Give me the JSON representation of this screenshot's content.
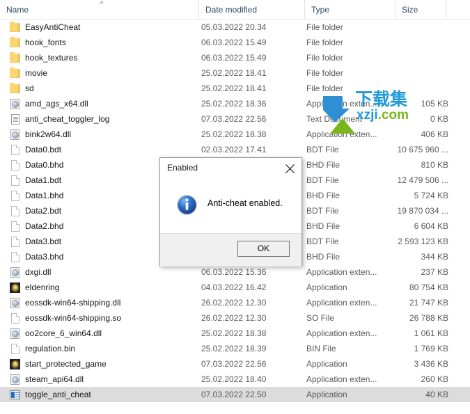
{
  "explorer": {
    "columns": [
      {
        "key": "name",
        "label": "Name"
      },
      {
        "key": "date",
        "label": "Date modified"
      },
      {
        "key": "type",
        "label": "Type"
      },
      {
        "key": "size",
        "label": "Size"
      }
    ],
    "sort": {
      "column": "Name",
      "direction": "ascending",
      "glyph": "^"
    },
    "rows": [
      {
        "name": "EasyAntiCheat",
        "date": "05.03.2022 20.34",
        "type": "File folder",
        "size": "",
        "icon": "folder-icon",
        "selected": false
      },
      {
        "name": "hook_fonts",
        "date": "06.03.2022 15.49",
        "type": "File folder",
        "size": "",
        "icon": "folder-icon",
        "selected": false
      },
      {
        "name": "hook_textures",
        "date": "06.03.2022 15.49",
        "type": "File folder",
        "size": "",
        "icon": "folder-icon",
        "selected": false
      },
      {
        "name": "movie",
        "date": "25.02.2022 18.41",
        "type": "File folder",
        "size": "",
        "icon": "folder-icon",
        "selected": false
      },
      {
        "name": "sd",
        "date": "25.02.2022 18.41",
        "type": "File folder",
        "size": "",
        "icon": "folder-icon",
        "selected": false
      },
      {
        "name": "amd_ags_x64.dll",
        "date": "25.02.2022 18.36",
        "type": "Application exten...",
        "size": "105 KB",
        "icon": "dll-icon",
        "selected": false
      },
      {
        "name": "anti_cheat_toggler_log",
        "date": "07.03.2022 22.56",
        "type": "Text Document",
        "size": "0 KB",
        "icon": "text-file-icon",
        "selected": false
      },
      {
        "name": "bink2w64.dll",
        "date": "25.02.2022 18.38",
        "type": "Application exten...",
        "size": "406 KB",
        "icon": "dll-icon",
        "selected": false
      },
      {
        "name": "Data0.bdt",
        "date": "02.03.2022 17.41",
        "type": "BDT File",
        "size": "10 675 960 ...",
        "icon": "generic-file-icon",
        "selected": false
      },
      {
        "name": "Data0.bhd",
        "date": "",
        "type": "BHD File",
        "size": "810 KB",
        "icon": "generic-file-icon",
        "selected": false
      },
      {
        "name": "Data1.bdt",
        "date": "",
        "type": "BDT File",
        "size": "12 479 506 ...",
        "icon": "generic-file-icon",
        "selected": false
      },
      {
        "name": "Data1.bhd",
        "date": "",
        "type": "BHD File",
        "size": "5 724 KB",
        "icon": "generic-file-icon",
        "selected": false
      },
      {
        "name": "Data2.bdt",
        "date": "",
        "type": "BDT File",
        "size": "19 870 034 ...",
        "icon": "generic-file-icon",
        "selected": false
      },
      {
        "name": "Data2.bhd",
        "date": "",
        "type": "BHD File",
        "size": "6 604 KB",
        "icon": "generic-file-icon",
        "selected": false
      },
      {
        "name": "Data3.bdt",
        "date": "",
        "type": "BDT File",
        "size": "2 593 123 KB",
        "icon": "generic-file-icon",
        "selected": false
      },
      {
        "name": "Data3.bhd",
        "date": "",
        "type": "BHD File",
        "size": "344 KB",
        "icon": "generic-file-icon",
        "selected": false
      },
      {
        "name": "dxgi.dll",
        "date": "06.03.2022 15.36",
        "type": "Application exten...",
        "size": "237 KB",
        "icon": "dll-icon",
        "selected": false
      },
      {
        "name": "eldenring",
        "date": "04.03.2022 16.42",
        "type": "Application",
        "size": "80 754 KB",
        "icon": "app-icon",
        "selected": false
      },
      {
        "name": "eossdk-win64-shipping.dll",
        "date": "26.02.2022 12.30",
        "type": "Application exten...",
        "size": "21 747 KB",
        "icon": "dll-icon",
        "selected": false
      },
      {
        "name": "eossdk-win64-shipping.so",
        "date": "26.02.2022 12.30",
        "type": "SO File",
        "size": "26 788 KB",
        "icon": "generic-file-icon",
        "selected": false
      },
      {
        "name": "oo2core_6_win64.dll",
        "date": "25.02.2022 18.38",
        "type": "Application exten...",
        "size": "1 061 KB",
        "icon": "dll-icon",
        "selected": false
      },
      {
        "name": "regulation.bin",
        "date": "25.02.2022 18.39",
        "type": "BIN File",
        "size": "1 769 KB",
        "icon": "generic-file-icon",
        "selected": false
      },
      {
        "name": "start_protected_game",
        "date": "07.03.2022 22.56",
        "type": "Application",
        "size": "3 436 KB",
        "icon": "app-icon",
        "selected": false
      },
      {
        "name": "steam_api64.dll",
        "date": "25.02.2022 18.40",
        "type": "Application exten...",
        "size": "260 KB",
        "icon": "dll-icon",
        "selected": false
      },
      {
        "name": "toggle_anti_cheat",
        "date": "07.03.2022 22.50",
        "type": "Application",
        "size": "40 KB",
        "icon": "console-app-icon",
        "selected": true
      }
    ]
  },
  "dialog": {
    "title": "Enabled",
    "message": "Anti-cheat enabled.",
    "ok_label": "OK",
    "close_label": "✕",
    "icon": "info-icon"
  },
  "watermark": {
    "text_cn": "下载集",
    "domain_x": "xzj",
    "domain_i": "i",
    "domain_dot": ".",
    "domain_com": "com",
    "colors": {
      "blue": "#1f9ad6",
      "green": "#7ab51d"
    }
  }
}
